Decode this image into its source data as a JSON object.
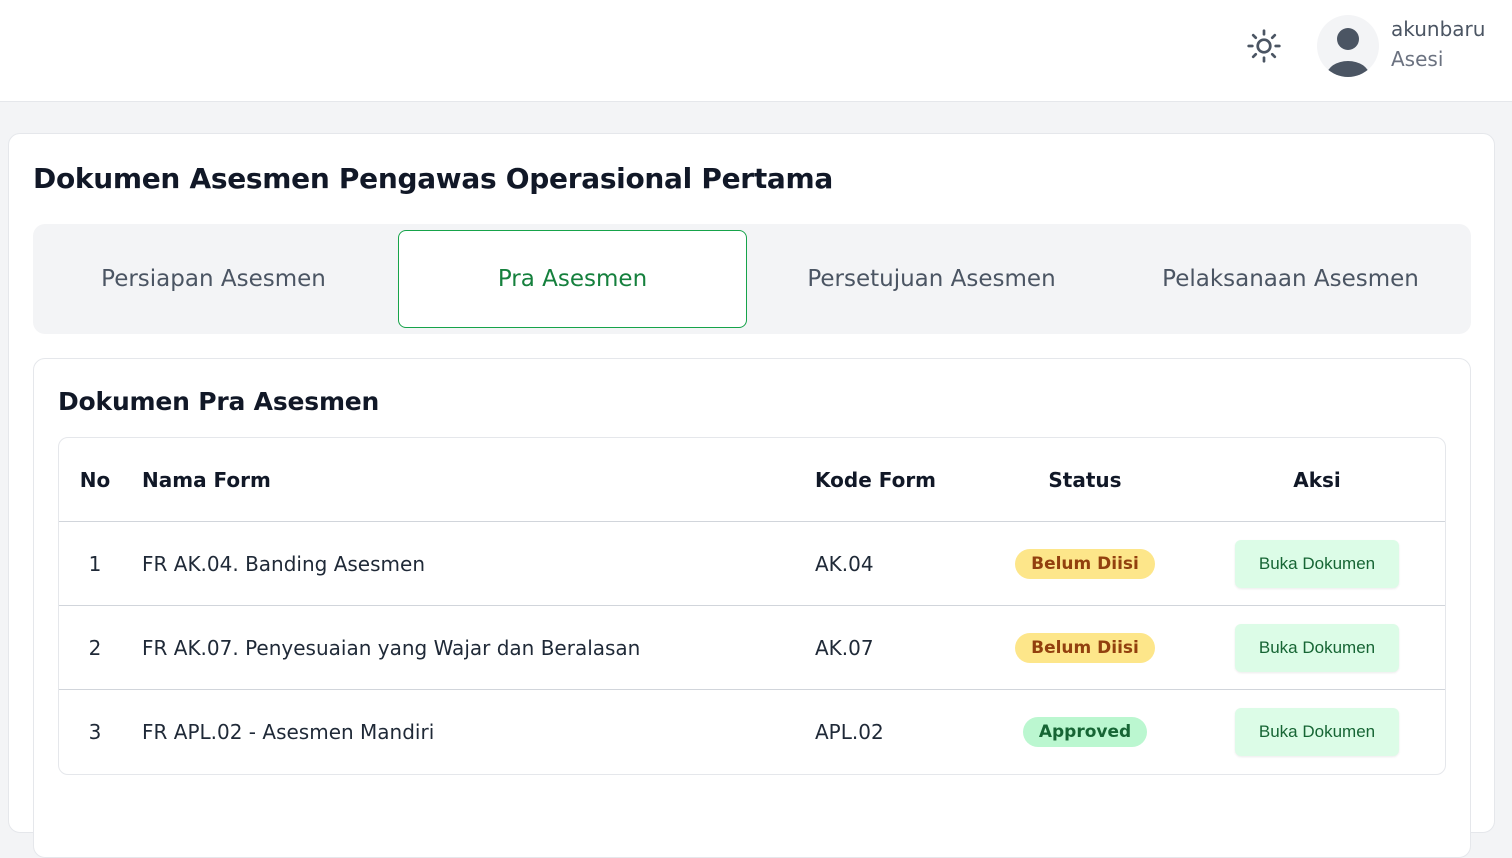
{
  "header": {
    "theme_icon": "sun-icon",
    "user": {
      "name": "akunbaru",
      "role": "Asesi",
      "avatar_icon": "user-avatar-icon"
    }
  },
  "page": {
    "title": "Dokumen Asesmen Pengawas Operasional Pertama"
  },
  "tabs": [
    {
      "label": "Persiapan Asesmen",
      "active": false
    },
    {
      "label": "Pra Asesmen",
      "active": true
    },
    {
      "label": "Persetujuan Asesmen",
      "active": false
    },
    {
      "label": "Pelaksanaan Asesmen",
      "active": false
    }
  ],
  "section": {
    "title": "Dokumen Pra Asesmen",
    "columns": [
      "No",
      "Nama Form",
      "Kode Form",
      "Status",
      "Aksi"
    ],
    "rows": [
      {
        "no": "1",
        "name": "FR AK.04. Banding Asesmen",
        "code": "AK.04",
        "status": "Belum Diisi",
        "status_type": "pending",
        "action": "Buka Dokumen"
      },
      {
        "no": "2",
        "name": "FR AK.07. Penyesuaian yang Wajar dan Beralasan",
        "code": "AK.07",
        "status": "Belum Diisi",
        "status_type": "pending",
        "action": "Buka Dokumen"
      },
      {
        "no": "3",
        "name": "FR APL.02 - Asesmen Mandiri",
        "code": "APL.02",
        "status": "Approved",
        "status_type": "approved",
        "action": "Buka Dokumen"
      }
    ]
  },
  "colors": {
    "accent_green": "#16a34a",
    "pending_bg": "#fde68a",
    "approved_bg": "#bbf7d0",
    "button_bg": "#dcfce7"
  }
}
